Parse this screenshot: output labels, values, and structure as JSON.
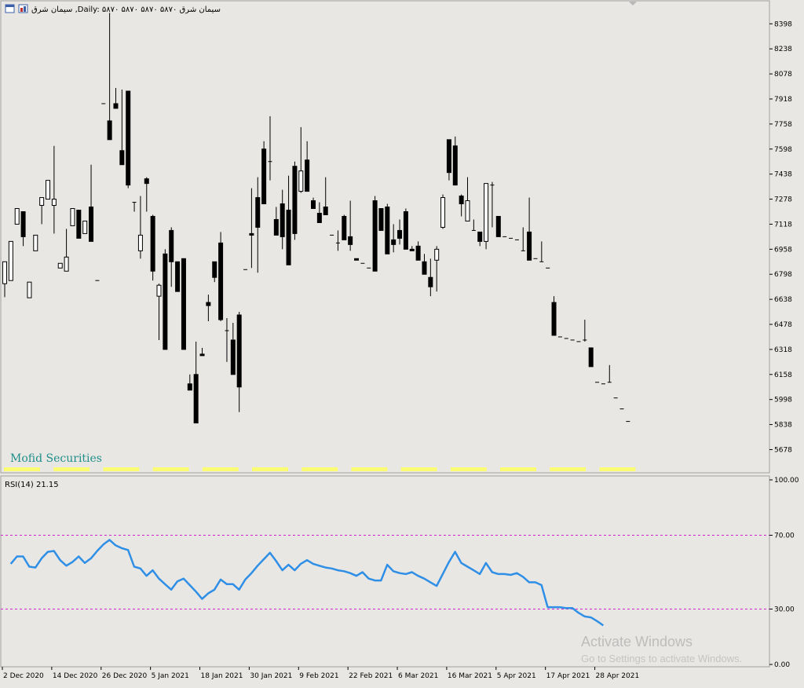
{
  "header": {
    "title": "سیمان شرق ,Daily: ۵۸۷۰ ۵۸۷۰ ۵۸۷۰ ۵۸۷۰ سیمان شرق",
    "icons": [
      "window-icon",
      "chart-type-icon"
    ]
  },
  "brand_label": "Mofid Securities",
  "watermark": {
    "title": "Activate Windows",
    "subtitle": "Go to Settings to activate Windows."
  },
  "rsi_label": "RSI(14) 21.15",
  "colors": {
    "background": "#e9e7e3",
    "bull_fill": "#ffffff",
    "bear_fill": "#000000",
    "rsi_line": "#2f8fe6",
    "level_line": "#d020d0",
    "brand": "#1f8f8a",
    "yellow_labels": "#ffff60"
  },
  "chart_data": [
    {
      "type": "candlestick",
      "title": "",
      "ylim": [
        5590,
        8510
      ],
      "y_ticks": [
        8398,
        8238,
        8078,
        7918,
        7758,
        7598,
        7438,
        7278,
        7118,
        6958,
        6798,
        6638,
        6478,
        6318,
        6158,
        5998,
        5838,
        5678
      ],
      "x_tick_labels": [
        "2 Dec 2020",
        "14 Dec 2020",
        "26 Dec 2020",
        "5 Jan 2021",
        "18 Jan 2021",
        "30 Jan 2021",
        "9 Feb 2021",
        "22 Feb 2021",
        "6 Mar 2021",
        "16 Mar 2021",
        "5 Apr 2021",
        "17 Apr 2021",
        "28 Apr 2021"
      ],
      "x_tick_bar_index": [
        0,
        8,
        16,
        24,
        32,
        40,
        48,
        56,
        64,
        72,
        80,
        88,
        96
      ],
      "grid": false,
      "ohlc": [
        [
          6738,
          6878,
          6652,
          6878
        ],
        [
          6758,
          6508,
          6938,
          7008
        ],
        [
          7118,
          7038,
          7218,
          7218
        ],
        [
          7198,
          6698,
          6978,
          7038
        ],
        [
          6648,
          6518,
          6808,
          6748
        ],
        [
          6948,
          6678,
          7048,
          7048
        ],
        [
          7238,
          7288,
          7118,
          7288
        ],
        [
          7278,
          7348,
          7378,
          7398
        ],
        [
          7238,
          7618,
          7058,
          7278
        ],
        [
          6838,
          6838,
          6858,
          6868
        ],
        [
          6818,
          7088,
          6818,
          6908
        ],
        [
          7108,
          6958,
          7228,
          7218
        ],
        [
          7208,
          6858,
          7468,
          7028
        ],
        [
          7058,
          6918,
          7268,
          7138
        ],
        [
          7228,
          7498,
          7008,
          7008
        ],
        [
          6758,
          6758,
          6758,
          6758
        ],
        [
          7888,
          7888,
          7888,
          7888
        ],
        [
          7778,
          8468,
          7658,
          7658
        ],
        [
          7888,
          7988,
          7858,
          7858
        ],
        [
          7588,
          7978,
          7498,
          7498
        ],
        [
          7968,
          7968,
          7348,
          7368
        ],
        [
          7258,
          7258,
          7198,
          7258
        ],
        [
          6948,
          7298,
          6898,
          7048
        ],
        [
          7408,
          7418,
          7198,
          7378
        ],
        [
          7168,
          7178,
          6758,
          6818
        ],
        [
          6658,
          6738,
          6378,
          6728
        ],
        [
          6928,
          6958,
          6318,
          6318
        ],
        [
          7078,
          7098,
          6718,
          6878
        ],
        [
          6878,
          6778,
          6798,
          6688
        ],
        [
          6898,
          6898,
          6398,
          6318
        ],
        [
          6098,
          6158,
          6058,
          6058
        ],
        [
          6158,
          6368,
          5848,
          5848
        ],
        [
          6288,
          6328,
          6278,
          6278
        ],
        [
          6618,
          6668,
          6498,
          6598
        ],
        [
          6878,
          6838,
          6748,
          6778
        ],
        [
          6998,
          7068,
          6498,
          6508
        ],
        [
          6438,
          6518,
          6238,
          6438
        ],
        [
          6378,
          6488,
          6218,
          6158
        ],
        [
          6538,
          6558,
          5918,
          6078
        ],
        [
          6828,
          6828,
          6828,
          6828
        ],
        [
          7058,
          7348,
          6838,
          7048
        ],
        [
          7288,
          7418,
          6808,
          7098
        ],
        [
          7598,
          7648,
          7398,
          7248
        ],
        [
          7518,
          7808,
          7398,
          7518
        ],
        [
          7148,
          7228,
          7098,
          7048
        ],
        [
          7248,
          7338,
          6958,
          7038
        ],
        [
          7208,
          7428,
          7048,
          6858
        ],
        [
          7488,
          7518,
          7018,
          7058
        ],
        [
          7328,
          7738,
          7318,
          7458
        ],
        [
          7528,
          7648,
          7448,
          7328
        ],
        [
          7268,
          7288,
          7218,
          7218
        ],
        [
          7188,
          7258,
          7128,
          7128
        ],
        [
          7228,
          7418,
          7198,
          7178
        ],
        [
          7048,
          7048,
          7048,
          7048
        ],
        [
          6998,
          7078,
          6948,
          6998
        ],
        [
          7168,
          7178,
          7068,
          7018
        ],
        [
          7038,
          7268,
          6948,
          6988
        ],
        [
          6898,
          6898,
          6888,
          6888
        ],
        [
          6868,
          6868,
          6868,
          6868
        ],
        [
          6838,
          6838,
          6838,
          6838
        ],
        [
          7268,
          7298,
          6828,
          6818
        ],
        [
          7218,
          7208,
          7128,
          7078
        ],
        [
          7228,
          7248,
          7028,
          6928
        ],
        [
          7018,
          7118,
          6938,
          6988
        ],
        [
          7078,
          7148,
          6988,
          7028
        ],
        [
          7198,
          7218,
          6978,
          6958
        ],
        [
          6958,
          6978,
          6948,
          6948
        ],
        [
          6978,
          7008,
          6888,
          6888
        ],
        [
          6878,
          6928,
          6808,
          6798
        ],
        [
          6778,
          6898,
          6658,
          6718
        ],
        [
          6888,
          6978,
          6688,
          6958
        ],
        [
          7098,
          7308,
          7088,
          7288
        ],
        [
          7658,
          7618,
          7398,
          7448
        ],
        [
          7618,
          7678,
          7398,
          7368
        ],
        [
          7298,
          7308,
          7168,
          7248
        ],
        [
          7138,
          7418,
          7248,
          7268
        ],
        [
          7078,
          7148,
          7098,
          7078
        ],
        [
          7068,
          7058,
          6978,
          7008
        ],
        [
          7008,
          7378,
          6958,
          7378
        ],
        [
          7368,
          7388,
          7098,
          7368
        ],
        [
          7168,
          7108,
          7038,
          7038
        ],
        [
          7038,
          7038,
          7038,
          7038
        ],
        [
          7028,
          7028,
          7028,
          7028
        ],
        [
          7018,
          7018,
          7018,
          7018
        ],
        [
          6948,
          7098,
          6958,
          6948
        ],
        [
          7068,
          7288,
          6918,
          6888
        ],
        [
          6898,
          6898,
          6898,
          6898
        ],
        [
          6878,
          7008,
          6878,
          6878
        ],
        [
          6838,
          6838,
          6838,
          6838
        ],
        [
          6618,
          6658,
          6408,
          6408
        ],
        [
          6398,
          6398,
          6398,
          6398
        ],
        [
          6388,
          6388,
          6388,
          6388
        ],
        [
          6378,
          6378,
          6378,
          6378
        ],
        [
          6368,
          6368,
          6368,
          6368
        ],
        [
          6378,
          6508,
          6368,
          6378
        ],
        [
          6328,
          6328,
          6208,
          6208
        ],
        [
          6108,
          6108,
          6108,
          6108
        ],
        [
          6098,
          6098,
          6098,
          6098
        ],
        [
          6108,
          6218,
          6108,
          6108
        ],
        [
          6008,
          6008,
          6008,
          6008
        ],
        [
          5938,
          5938,
          5938,
          5938
        ],
        [
          5858,
          5858,
          5858,
          5858
        ]
      ]
    },
    {
      "type": "line",
      "title": "RSI(14) 21.15",
      "ylim": [
        0,
        100
      ],
      "y_ticks": [
        100.0,
        70.0,
        30.0,
        0.0
      ],
      "y_tick_labels": [
        "100.00",
        "70.00",
        "30.00",
        "0.00"
      ],
      "levels": [
        70,
        30
      ],
      "series": [
        {
          "name": "RSI(14)",
          "values": [
            54.5,
            58.5,
            58.5,
            53.0,
            52.5,
            57.5,
            61.0,
            61.5,
            56.5,
            53.5,
            55.5,
            58.5,
            55.0,
            57.5,
            61.5,
            65.0,
            67.5,
            64.5,
            63.0,
            62.0,
            53.0,
            52.0,
            48.0,
            51.0,
            46.5,
            43.5,
            40.5,
            45.0,
            46.5,
            43.0,
            39.5,
            35.5,
            38.5,
            40.5,
            46.0,
            43.5,
            43.5,
            40.5,
            46.0,
            49.5,
            53.5,
            57.0,
            60.5,
            56.0,
            51.0,
            54.0,
            51.0,
            54.5,
            56.5,
            54.5,
            53.5,
            52.5,
            52.0,
            51.0,
            50.5,
            49.5,
            48.0,
            50.0,
            46.5,
            45.5,
            45.5,
            54.0,
            50.5,
            49.5,
            49.0,
            50.0,
            48.0,
            46.5,
            44.5,
            42.5,
            49.0,
            55.5,
            61.0,
            55.0,
            53.0,
            51.0,
            49.0,
            55.0,
            50.0,
            49.0,
            49.0,
            48.5,
            49.5,
            47.5,
            44.5,
            44.5,
            43.0,
            31.0,
            31.0,
            31.0,
            30.5,
            30.5,
            28.0,
            26.0,
            25.5,
            23.5,
            21.15
          ]
        }
      ]
    }
  ],
  "yellow_strip_count": 13
}
